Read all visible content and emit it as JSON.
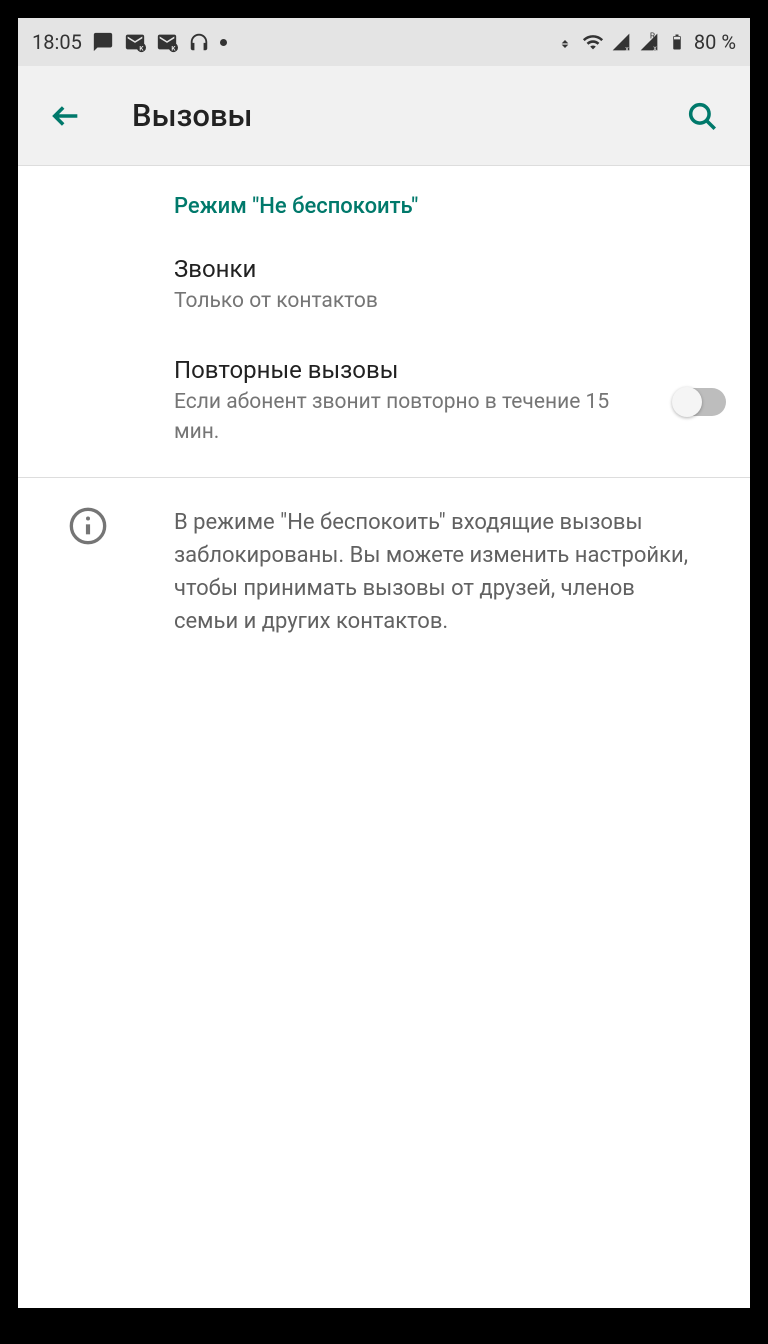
{
  "statusBar": {
    "time": "18:05",
    "batteryPercent": "80 %"
  },
  "appBar": {
    "title": "Вызовы"
  },
  "section": {
    "header": "Режим \"Не беспокоить\""
  },
  "items": {
    "calls": {
      "title": "Звонки",
      "subtitle": "Только от контактов"
    },
    "repeat": {
      "title": "Повторные вызовы",
      "subtitle": "Если абонент звонит повторно в течение 15 мин."
    }
  },
  "info": {
    "text": "В режиме \"Не беспокоить\" входящие вызовы заблокированы. Вы можете изменить настройки, чтобы принимать вызовы от друзей, членов семьи и других контактов."
  }
}
